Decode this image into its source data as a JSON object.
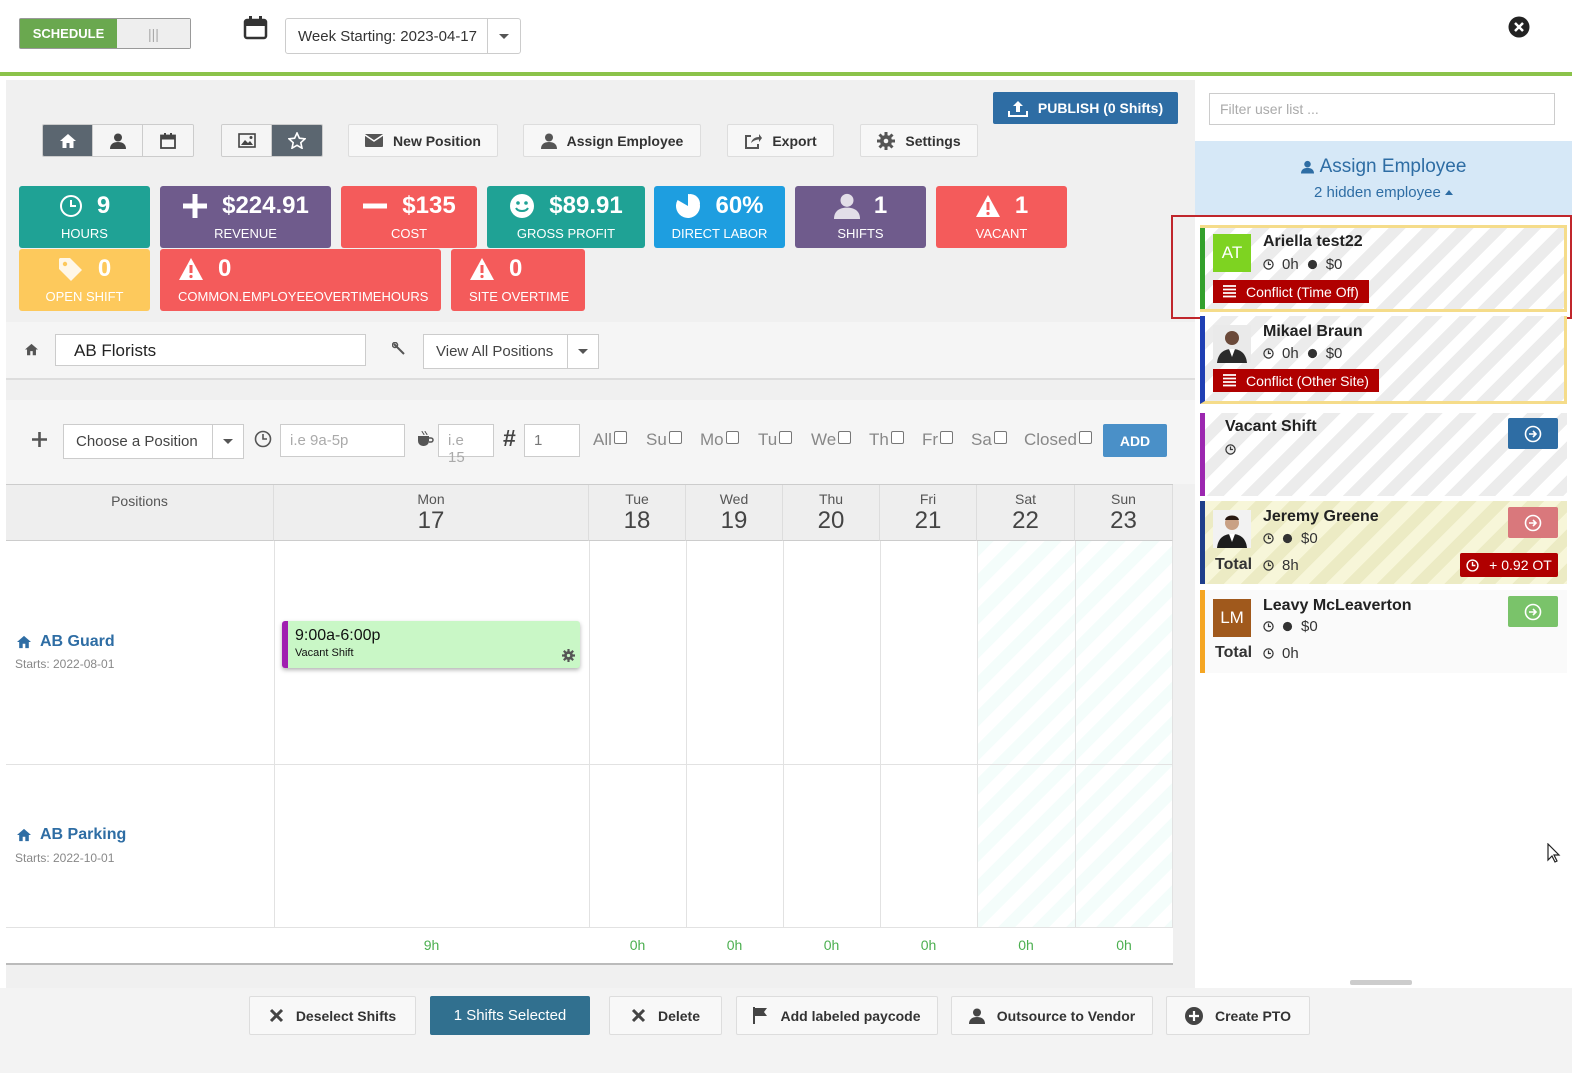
{
  "toolbar": {
    "schedule_label": "SCHEDULE",
    "toggle_off_glyph": "|||",
    "week_label": "Week Starting: 2023-04-17"
  },
  "actions": {
    "publish": "PUBLISH (0 Shifts)",
    "new_position": "New Position",
    "assign_employee": "Assign Employee",
    "export": "Export",
    "settings": "Settings"
  },
  "stats": [
    {
      "value": "9",
      "label": "HOURS",
      "color": "#1fa295",
      "icon": "clock-icon"
    },
    {
      "value": "$224.91",
      "label": "REVENUE",
      "color": "#6f5b8c",
      "icon": "plus-icon"
    },
    {
      "value": "$135",
      "label": "COST",
      "color": "#f45b5b",
      "icon": "minus-icon"
    },
    {
      "value": "$89.91",
      "label": "GROSS PROFIT",
      "color": "#1fa295",
      "icon": "smile-icon"
    },
    {
      "value": "60%",
      "label": "DIRECT LABOR",
      "color": "#1e9ee0",
      "icon": "pie-icon"
    },
    {
      "value": "1",
      "label": "SHIFTS",
      "color": "#6f5b8c",
      "icon": "user-icon"
    },
    {
      "value": "1",
      "label": "VACANT",
      "color": "#f45b5b",
      "icon": "warning-icon"
    },
    {
      "value": "0",
      "label": "OPEN SHIFT",
      "color": "#fdc95c",
      "icon": "tag-icon"
    },
    {
      "value": "0",
      "label": "COMMON.EMPLOYEEOVERTIMEHOURS",
      "color": "#f45b5b",
      "icon": "warning-icon"
    },
    {
      "value": "0",
      "label": "SITE OVERTIME",
      "color": "#f45b5b",
      "icon": "warning-icon"
    }
  ],
  "filters": {
    "site": "AB Florists",
    "positions_select": "View All Positions"
  },
  "add_shift": {
    "position_placeholder": "Choose a Position",
    "time_placeholder": "i.e 9a-5p",
    "break_placeholder": "i.e 15",
    "count_value": "1",
    "days": [
      "All",
      "Su",
      "Mo",
      "Tu",
      "We",
      "Th",
      "Fr",
      "Sa",
      "Closed"
    ],
    "add_label": "ADD"
  },
  "grid": {
    "positions_header": "Positions",
    "days": [
      {
        "name": "Mon",
        "num": "17",
        "total": "9h"
      },
      {
        "name": "Tue",
        "num": "18",
        "total": "0h"
      },
      {
        "name": "Wed",
        "num": "19",
        "total": "0h"
      },
      {
        "name": "Thu",
        "num": "20",
        "total": "0h"
      },
      {
        "name": "Fri",
        "num": "21",
        "total": "0h"
      },
      {
        "name": "Sat",
        "num": "22",
        "total": "0h"
      },
      {
        "name": "Sun",
        "num": "23",
        "total": "0h"
      }
    ],
    "positions": [
      {
        "name": "AB Guard",
        "starts": "Starts: 2022-08-01"
      },
      {
        "name": "AB Parking",
        "starts": "Starts: 2022-10-01"
      }
    ],
    "shift": {
      "time": "9:00a-6:00p",
      "label": "Vacant Shift",
      "border_color": "#a020b0"
    }
  },
  "panel": {
    "filter_placeholder": "Filter user list ...",
    "title": "Assign Employee",
    "hidden": "2 hidden employee",
    "employees": [
      {
        "name": "Ariella test22",
        "initials": "AT",
        "hours": "0h",
        "cost": "$0",
        "conflict": "Conflict (Time Off)",
        "bar": "#33a02c",
        "avatar_color": "#7ed321"
      },
      {
        "name": "Mikael Braun",
        "hours": "0h",
        "cost": "$0",
        "conflict": "Conflict (Other Site)",
        "bar": "#1f3fb4"
      },
      {
        "name": "Vacant Shift",
        "bar": "#9c27b0"
      },
      {
        "name": "Jeremy Greene",
        "cost": "$0",
        "total_label": "Total",
        "total": "8h",
        "ot": "+ 0.92 OT",
        "bar": "#1f3f8b"
      },
      {
        "name": "Leavy McLeaverton",
        "initials": "LM",
        "cost": "$0",
        "total_label": "Total",
        "total": "0h",
        "bar": "#f5a623",
        "avatar_color": "#a0591c"
      }
    ]
  },
  "bottom": {
    "deselect": "Deselect Shifts",
    "selected": "1 Shifts Selected",
    "delete": "Delete",
    "paycode": "Add labeled paycode",
    "outsource": "Outsource to Vendor",
    "pto": "Create PTO"
  }
}
